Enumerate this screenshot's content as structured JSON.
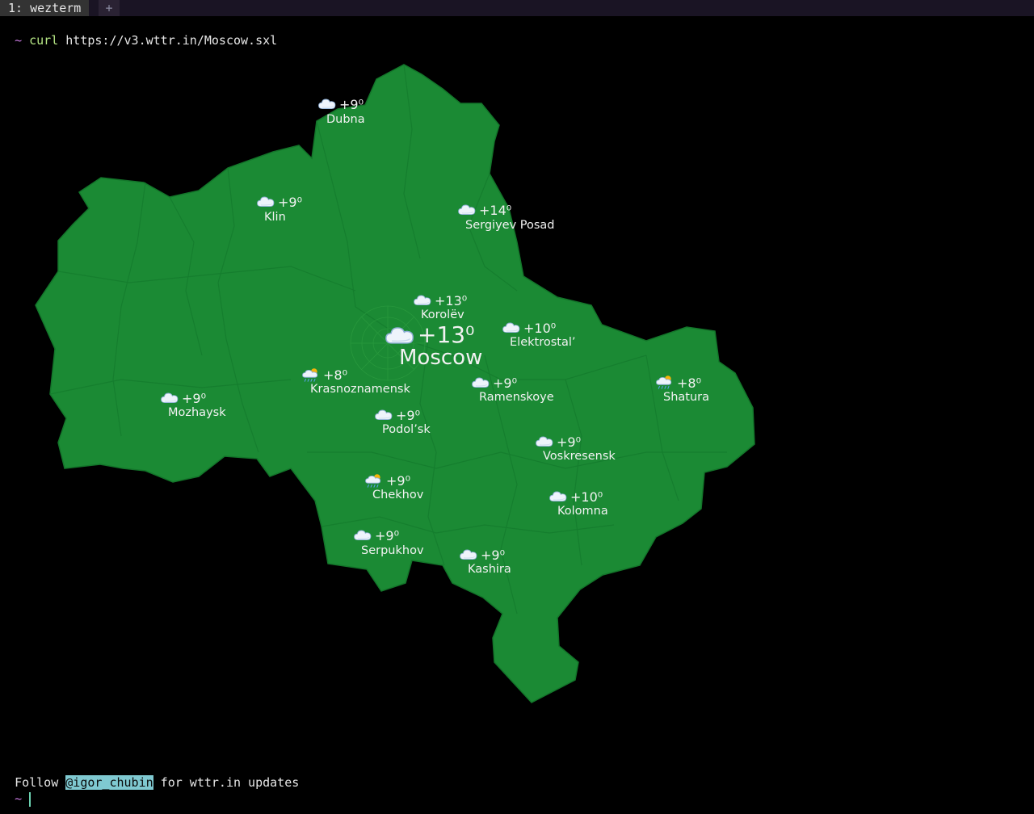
{
  "tabbar": {
    "active_tab": "1: wezterm",
    "new_tab": "+"
  },
  "terminal": {
    "prompt": "~",
    "command": "curl",
    "command_args": " https://v3.wttr.in/Moscow.sxl",
    "footer_prefix": "Follow ",
    "footer_handle": "@igor_chubin",
    "footer_suffix": " for wttr.in updates",
    "prompt2": "~"
  },
  "map": {
    "region_color": "#1b8a34",
    "main_city": {
      "name": "Moscow",
      "temp": "+13⁰",
      "icon": "cloud-icon"
    },
    "cities": [
      {
        "name": "Dubna",
        "temp": "+9⁰",
        "icon": "cloud-icon"
      },
      {
        "name": "Klin",
        "temp": "+9⁰",
        "icon": "cloud-icon"
      },
      {
        "name": "Sergiyev Posad",
        "temp": "+14⁰",
        "icon": "cloud-icon"
      },
      {
        "name": "Korolëv",
        "temp": "+13⁰",
        "icon": "cloud-icon"
      },
      {
        "name": "Elektrostal’",
        "temp": "+10⁰",
        "icon": "cloud-icon"
      },
      {
        "name": "Krasnoznamensk",
        "temp": "+8⁰",
        "icon": "sun-cloud-rain-icon"
      },
      {
        "name": "Ramenskoye",
        "temp": "+9⁰",
        "icon": "cloud-icon"
      },
      {
        "name": "Shatura",
        "temp": "+8⁰",
        "icon": "sun-cloud-rain-icon"
      },
      {
        "name": "Mozhaysk",
        "temp": "+9⁰",
        "icon": "cloud-icon"
      },
      {
        "name": "Podol’sk",
        "temp": "+9⁰",
        "icon": "cloud-icon"
      },
      {
        "name": "Voskresensk",
        "temp": "+9⁰",
        "icon": "cloud-icon"
      },
      {
        "name": "Chekhov",
        "temp": "+9⁰",
        "icon": "sun-cloud-rain-icon"
      },
      {
        "name": "Kolomna",
        "temp": "+10⁰",
        "icon": "cloud-icon"
      },
      {
        "name": "Serpukhov",
        "temp": "+9⁰",
        "icon": "cloud-icon"
      },
      {
        "name": "Kashira",
        "temp": "+9⁰",
        "icon": "cloud-icon"
      }
    ]
  }
}
